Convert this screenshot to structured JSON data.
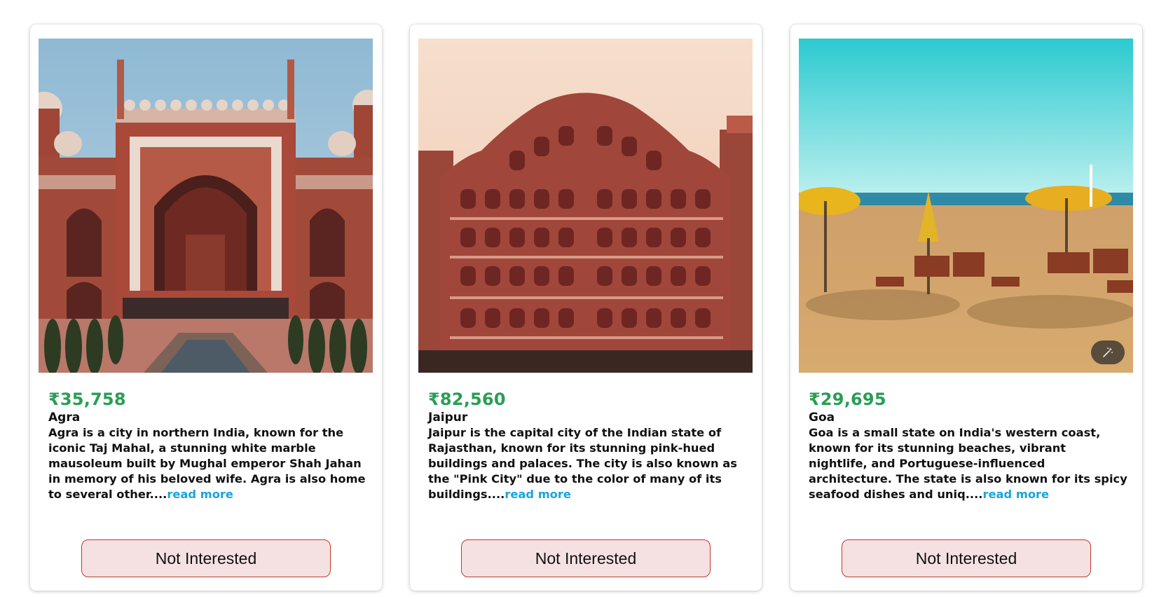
{
  "cards": [
    {
      "price": "₹35,758",
      "city": "Agra",
      "description": "Agra is a city in northern India, known for the iconic Taj Mahal, a stunning white marble mausoleum built by Mughal emperor Shah Jahan in memory of his beloved wife. Agra is also home to several other....",
      "read_more": "read more",
      "button_label": "Not Interested",
      "image": "taj-mahal-gate-photo"
    },
    {
      "price": "₹82,560",
      "city": "Jaipur",
      "description": "Jaipur is the capital city of the Indian state of Rajasthan, known for its stunning pink-hued buildings and palaces. The city is also known as the \"Pink City\" due to the color of many of its buildings....",
      "read_more": "read more",
      "button_label": "Not Interested",
      "image": "hawa-mahal-photo"
    },
    {
      "price": "₹29,695",
      "city": "Goa",
      "description": "Goa is a small state on India's western coast, known for its stunning beaches, vibrant nightlife, and Portuguese-influenced architecture. The state is also known for its spicy seafood dishes and uniq....",
      "read_more": "read more",
      "button_label": "Not Interested",
      "image": "goa-beach-photo"
    }
  ],
  "colors": {
    "price": "#2a9d55",
    "link": "#1aa3dc",
    "button_bg": "#f6e1e2",
    "button_border": "#c0392b"
  }
}
